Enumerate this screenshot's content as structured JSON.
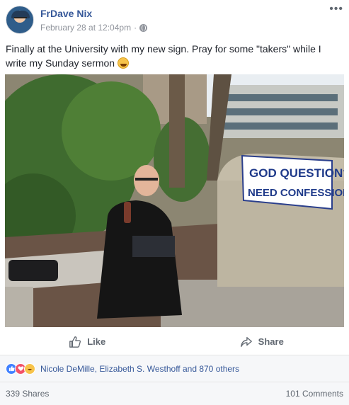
{
  "post": {
    "author": "FrDave Nix",
    "timestamp": "February 28 at 12:04pm",
    "separator": "·",
    "text": "Finally at the University with my new sign. Pray for some \"takers\" while I write my Sunday sermon"
  },
  "photo": {
    "sign_line1": "GOD QUESTION?",
    "sign_line2": "NEED CONFESSION?"
  },
  "actions": {
    "like_label": "Like",
    "share_label": "Share"
  },
  "reactions": {
    "types": [
      "like-icon",
      "love-icon",
      "haha-icon"
    ],
    "summary": "Nicole DeMille, Elizabeth S. Westhoff and 870 others"
  },
  "stats": {
    "shares": "339 Shares",
    "comments": "101 Comments"
  },
  "colors": {
    "link": "#365899",
    "secondary": "#90949c",
    "like_blue": "#4080ff",
    "love_red": "#f25268",
    "haha_yellow": "#f7c34a"
  }
}
